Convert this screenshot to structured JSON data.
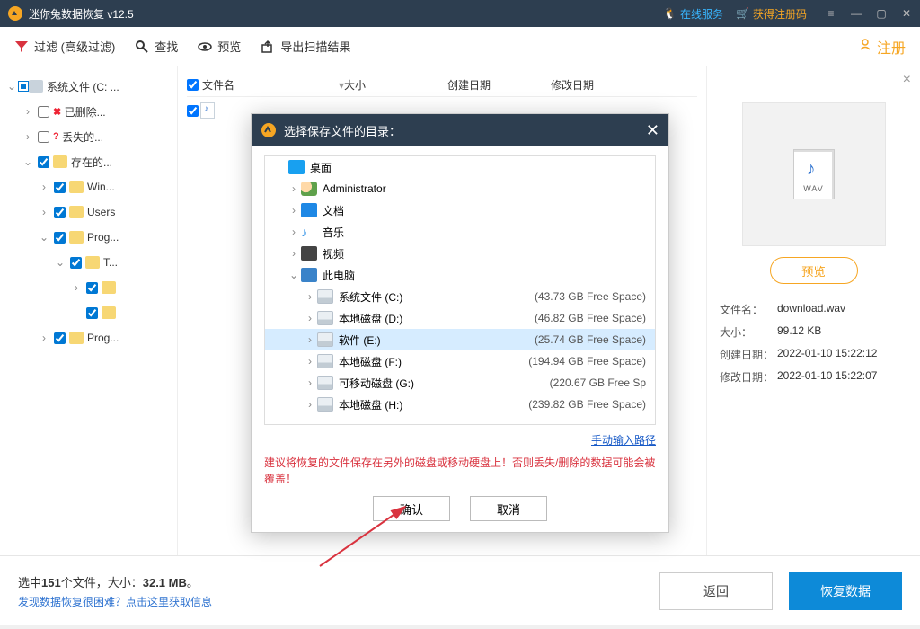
{
  "app": {
    "title": "迷你兔数据恢复 v12.5"
  },
  "titlebar": {
    "online_service": "在线服务",
    "get_reg_code": "获得注册码"
  },
  "toolbar": {
    "filter": "过滤 (高级过滤)",
    "find": "查找",
    "preview": "预览",
    "export": "导出扫描结果",
    "register": "注册"
  },
  "tree": {
    "root": "系统文件 (C: ...",
    "deleted": "已删除...",
    "lost": "丢失的...",
    "existing": "存在的...",
    "win": "Win...",
    "users": "Users",
    "prog1": "Prog...",
    "t": "T...",
    "prog2": "Prog..."
  },
  "columns": {
    "name": "文件名",
    "size": "大小",
    "created": "创建日期",
    "modified": "修改日期"
  },
  "preview": {
    "btn": "预览",
    "name_k": "文件名：",
    "name_v": "download.wav",
    "size_k": "大小：",
    "size_v": "99.12 KB",
    "created_k": "创建日期：",
    "created_v": "2022-01-10 15:22:12",
    "modified_k": "修改日期：",
    "modified_v": "2022-01-10 15:22:07"
  },
  "footer": {
    "summary_pre": "选中",
    "summary_count": "151",
    "summary_mid": "个文件，大小：",
    "summary_size": "32.1 MB",
    "summary_end": "。",
    "hint": "发现数据恢复很困难？点击这里获取信息",
    "back": "返回",
    "recover": "恢复数据"
  },
  "modal": {
    "title": "选择保存文件的目录：",
    "desktop": "桌面",
    "admin": "Administrator",
    "docs": "文档",
    "music": "音乐",
    "video": "视频",
    "this_pc": "此电脑",
    "drives": [
      {
        "label": "系统文件 (C:)",
        "free": "(43.73 GB Free Space)"
      },
      {
        "label": "本地磁盘 (D:)",
        "free": "(46.82 GB Free Space)"
      },
      {
        "label": "软件 (E:)",
        "free": "(25.74 GB Free Space)",
        "selected": true
      },
      {
        "label": "本地磁盘 (F:)",
        "free": "(194.94 GB Free Space)"
      },
      {
        "label": "可移动磁盘 (G:)",
        "free": "(220.67 GB Free Sp"
      },
      {
        "label": "本地磁盘 (H:)",
        "free": "(239.82 GB Free Space)"
      }
    ],
    "manual_path": "手动输入路径",
    "warning": "建议将恢复的文件保存在另外的磁盘或移动硬盘上！否则丢失/删除的数据可能会被覆盖！",
    "ok": "确认",
    "cancel": "取消"
  }
}
